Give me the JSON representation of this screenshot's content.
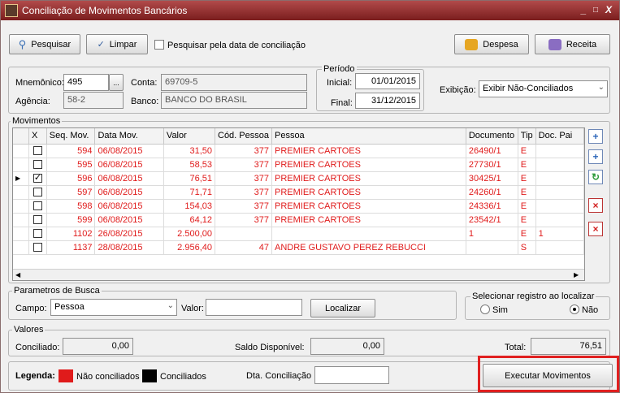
{
  "window": {
    "title": "Conciliação de Movimentos Bancários",
    "controls": [
      "_",
      "□",
      "X"
    ]
  },
  "toolbar": {
    "search_label": "Pesquisar",
    "clear_label": "Limpar",
    "by_reconcile_date_label": "Pesquisar pela data de conciliação",
    "expense_label": "Despesa",
    "income_label": "Receita"
  },
  "account": {
    "mnemonic_label": "Mnemônico:",
    "mnemonic_value": "495",
    "browse_label": "...",
    "account_label": "Conta:",
    "account_value": "69709-5",
    "agency_label": "Agência:",
    "agency_value": "58-2",
    "bank_label": "Banco:",
    "bank_value": "BANCO DO BRASIL"
  },
  "period": {
    "group_label": "Período",
    "start_label": "Inicial:",
    "start_value": "01/01/2015",
    "end_label": "Final:",
    "end_value": "31/12/2015"
  },
  "display": {
    "label": "Exibição:",
    "value": "Exibir Não-Conciliados"
  },
  "movements": {
    "group_label": "Movimentos",
    "columns": [
      "X",
      "Seq. Mov.",
      "Data Mov.",
      "Valor",
      "Cód. Pessoa",
      "Pessoa",
      "Documento",
      "Tip",
      "Doc. Pai"
    ],
    "rows": [
      {
        "checked": false,
        "seq": "594",
        "date": "06/08/2015",
        "value": "31,50",
        "code": "377",
        "person": "PREMIER CARTOES",
        "doc": "26490/1",
        "type": "E",
        "parent": ""
      },
      {
        "checked": false,
        "seq": "595",
        "date": "06/08/2015",
        "value": "58,53",
        "code": "377",
        "person": "PREMIER CARTOES",
        "doc": "27730/1",
        "type": "E",
        "parent": ""
      },
      {
        "checked": true,
        "seq": "596",
        "date": "06/08/2015",
        "value": "76,51",
        "code": "377",
        "person": "PREMIER CARTOES",
        "doc": "30425/1",
        "type": "E",
        "parent": ""
      },
      {
        "checked": false,
        "seq": "597",
        "date": "06/08/2015",
        "value": "71,71",
        "code": "377",
        "person": "PREMIER CARTOES",
        "doc": "24260/1",
        "type": "E",
        "parent": ""
      },
      {
        "checked": false,
        "seq": "598",
        "date": "06/08/2015",
        "value": "154,03",
        "code": "377",
        "person": "PREMIER CARTOES",
        "doc": "24336/1",
        "type": "E",
        "parent": ""
      },
      {
        "checked": false,
        "seq": "599",
        "date": "06/08/2015",
        "value": "64,12",
        "code": "377",
        "person": "PREMIER CARTOES",
        "doc": "23542/1",
        "type": "E",
        "parent": ""
      },
      {
        "checked": false,
        "seq": "1102",
        "date": "26/08/2015",
        "value": "2.500,00",
        "code": "",
        "person": "",
        "doc": "1",
        "type": "E",
        "parent": "1"
      },
      {
        "checked": false,
        "seq": "1137",
        "date": "28/08/2015",
        "value": "2.956,40",
        "code": "47",
        "person": "ANDRE GUSTAVO PEREZ REBUCCI",
        "doc": "",
        "type": "S",
        "parent": ""
      }
    ],
    "selected_row": 2
  },
  "search_params": {
    "group_label": "Parametros de Busca",
    "field_label": "Campo:",
    "field_value": "Pessoa",
    "value_label": "Valor:",
    "value_value": "",
    "locate_label": "Localizar"
  },
  "select_on_locate": {
    "group_label": "Selecionar registro ao localizar",
    "yes_label": "Sim",
    "no_label": "Não",
    "selected": "Não"
  },
  "values": {
    "group_label": "Valores",
    "reconciled_label": "Conciliado:",
    "reconciled_value": "0,00",
    "available_label": "Saldo Disponível:",
    "available_value": "0,00",
    "total_label": "Total:",
    "total_value": "76,51"
  },
  "footer": {
    "legend_label": "Legenda:",
    "unreconciled_label": "Não conciliados",
    "reconciled_label": "Conciliados",
    "reconcile_date_label": "Dta. Conciliação",
    "reconcile_date_value": "",
    "execute_label": "Executar Movimentos"
  },
  "colors": {
    "unreconciled": "#e01b1b",
    "reconciled": "#000000",
    "title_bar": "#8e2b2b",
    "highlight": "#e02020"
  }
}
